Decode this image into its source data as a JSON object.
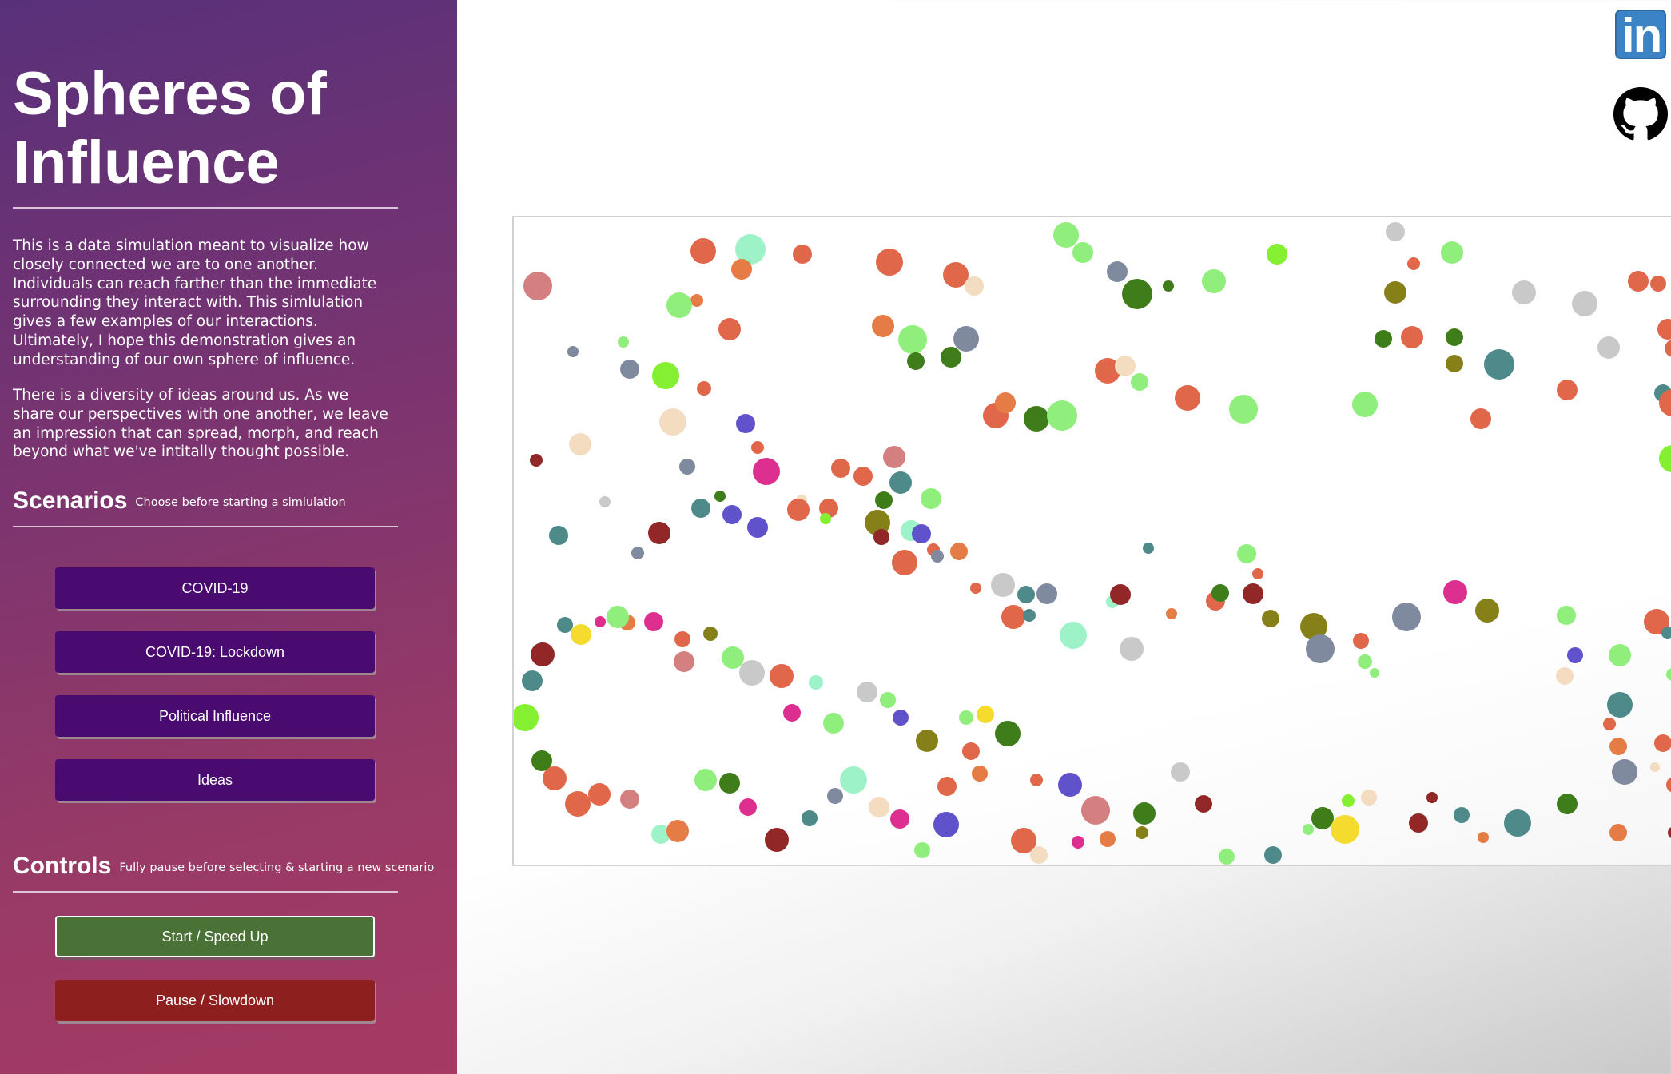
{
  "sidebar": {
    "title": "Spheres of Influence",
    "intro_paragraph_1": "This is a data simulation meant to visualize how closely connected we are to one another. Individuals can reach farther than the immediate surrounding they interact with. This simlulation gives a few examples of our interactions. Ultimately, I hope this demonstration gives an understanding of our own sphere of influence.",
    "intro_paragraph_2": "There is a diversity of ideas around us. As we share our perspectives with one another, we leave an impression that can spread, morph, and reach beyond what we've intitally thought possible.",
    "scenarios": {
      "heading": "Scenarios",
      "subheading": "Choose before starting a simlulation",
      "buttons": [
        "COVID-19",
        "COVID-19: Lockdown",
        "Political Influence",
        "Ideas"
      ]
    },
    "controls": {
      "heading": "Controls",
      "subheading": "Fully pause before selecting & starting a new scenario",
      "start_label": "Start / Speed Up",
      "pause_label": "Pause / Slowdown"
    }
  },
  "social": {
    "linkedin_text": "in",
    "linkedin_icon": "linkedin-icon",
    "github_icon": "github-icon"
  },
  "colors": {
    "sidebar_gradient_start": "#58307a",
    "sidebar_gradient_end": "#a53a63",
    "scenario_button": "#4a0b70",
    "start_button": "#4a7136",
    "pause_button": "#8e1f1f",
    "linkedin_blue": "#3b83c5",
    "sphere_palette": [
      "#e1674a",
      "#d48080",
      "#9ef2c8",
      "#90ef7c",
      "#85ef32",
      "#3f7d1b",
      "#4e8a8a",
      "#808a9e",
      "#c9c9c9",
      "#5f52cb",
      "#dd2f8f",
      "#922727",
      "#868019",
      "#f4db2e",
      "#f3dcc0",
      "#e57b45"
    ]
  }
}
